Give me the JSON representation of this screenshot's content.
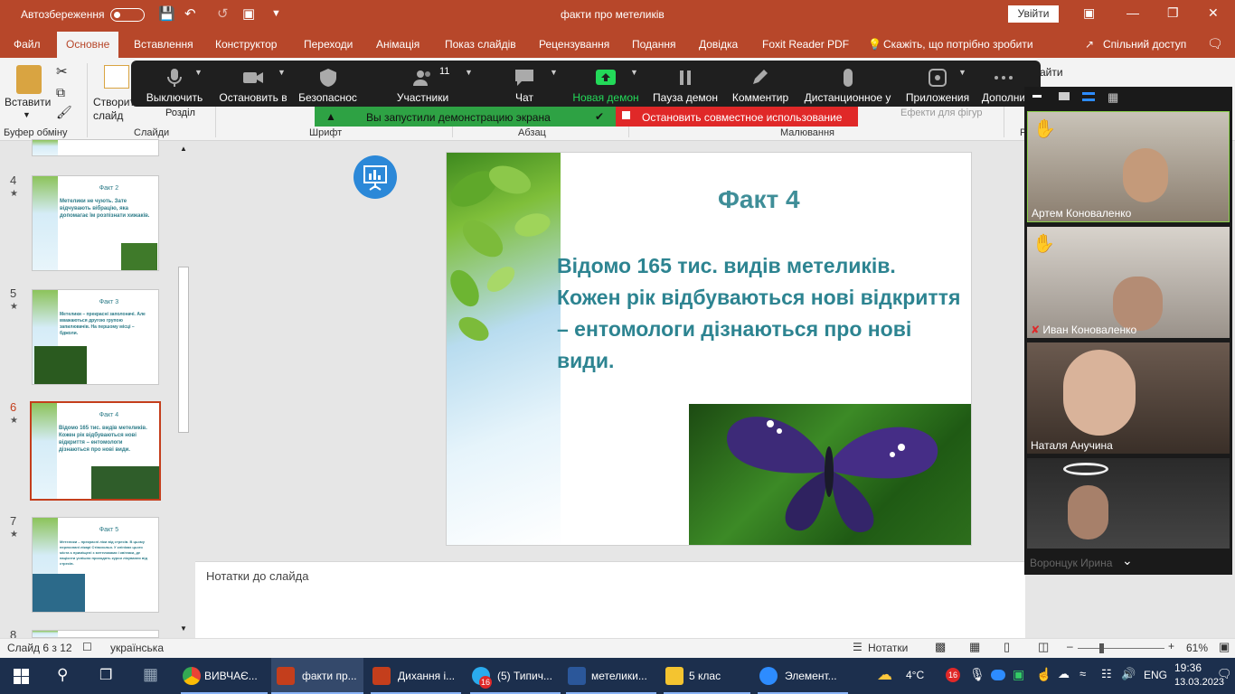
{
  "titlebar": {
    "autosave_label": "Автозбереження",
    "doc_title": "факти про метеликів",
    "signin_label": "Увійти"
  },
  "ribbon_tabs": [
    "Файл",
    "Основне",
    "Вставлення",
    "Конструктор",
    "Переходи",
    "Анімація",
    "Показ слайдів",
    "Рецензування",
    "Подання",
    "Довідка",
    "Foxit Reader PDF",
    "Скажіть, що потрібно зробити",
    "Спільний доступ"
  ],
  "ribbon": {
    "paste_label": "Вставити",
    "new_slide_label": "Створити слайд",
    "section_label": "Розділ",
    "find_label": "айти",
    "effects_label": "Ефекти для фігур",
    "groups": [
      "Буфер обміну",
      "Слайди",
      "Шрифт",
      "Абзац",
      "Малювання",
      "Р"
    ]
  },
  "zoom_toolbar": {
    "items": [
      "Выключить",
      "Остановить в",
      "Безопаснос",
      "Участники",
      "Чат",
      "Новая демон",
      "Пауза демон",
      "Комментир",
      "Дистанционное у",
      "Приложения",
      "Дополни"
    ],
    "participants_count": "11",
    "share_banner": "Вы запустили демонстрацию экрана",
    "stop_share": "Остановить совместное использование"
  },
  "slides": [
    {
      "num": "4",
      "title": "Факт 2",
      "body": "Метелики не чують. Зате відчувають вібрацію, яка допомагає їм розпізнати хижаків."
    },
    {
      "num": "5",
      "title": "Факт 3",
      "body": "Метелики – прекрасні заполоначі. Але вважаються другою групою запилювачів. На першому місці – бджоли."
    },
    {
      "num": "6",
      "title": "Факт 4",
      "body": "Відомо 165 тис. видів метеликів. Кожен рік відбуваються нові відкриття – ентомологи дізнаються про нові види."
    },
    {
      "num": "7",
      "title": "Факт 5",
      "body": "Метелики – прекрасні ліки від стресів. В цьому переконані лікарі Стівсхолья. У клініках цього міста є приміщені з метеликами і квітами, де пацієнти успішно проходять курси лікування від стресів."
    },
    {
      "num": "8",
      "title": "",
      "body": ""
    }
  ],
  "current_slide": {
    "title": "Факт 4",
    "body": "Відомо 165 тис. видів метеликів. Кожен рік відбуваються нові відкриття – ентомологи дізнаються про нові види."
  },
  "notes_placeholder": "Нотатки до слайда",
  "statusbar": {
    "slide_info": "Слайд 6 з 12",
    "language": "українська",
    "notes_label": "Нотатки",
    "zoom": "61%"
  },
  "gallery": {
    "participants": [
      {
        "name": "Артем Коноваленко",
        "hand": true,
        "muted": false
      },
      {
        "name": "Иван Коноваленко",
        "hand": true,
        "muted": true
      },
      {
        "name": "Наталя Анучина",
        "hand": false,
        "muted": false
      },
      {
        "name": "Воронцук Ирина",
        "hand": false,
        "muted": false
      }
    ]
  },
  "taskbar": {
    "apps": [
      {
        "label": "ВИВЧАЄ...",
        "color": "#34a853"
      },
      {
        "label": "факти пр...",
        "color": "#c43e1c"
      },
      {
        "label": "Дихання і...",
        "color": "#c43e1c"
      },
      {
        "label": "(5) Типич...",
        "color": "#2aabee",
        "badge": "16"
      },
      {
        "label": "метелики...",
        "color": "#2b579a"
      },
      {
        "label": "5 клас",
        "color": "#f4c430"
      },
      {
        "label": "Элемент...",
        "color": "#2d8cff"
      }
    ],
    "weather": "4°C",
    "lang": "ENG",
    "time": "19:36",
    "date": "13.03.2023",
    "notif_badge": "16"
  }
}
